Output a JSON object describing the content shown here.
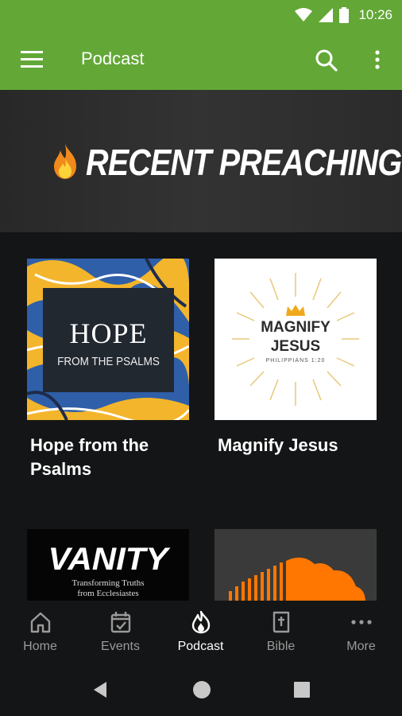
{
  "status_bar": {
    "time": "10:26",
    "icons": [
      "wifi-icon",
      "cellular-signal-icon",
      "battery-icon"
    ]
  },
  "app_bar": {
    "title": "Podcast",
    "icons": [
      "menu-icon",
      "search-icon",
      "more-vertical-icon"
    ]
  },
  "banner": {
    "icon": "flame-icon",
    "text": "RECENT PREACHING"
  },
  "podcasts": [
    {
      "title": "Hope from the Psalms",
      "art_title": "HOPE",
      "art_subtitle": "FROM THE PSALMS"
    },
    {
      "title": "Magnify Jesus",
      "art_line1": "MAGNIFY",
      "art_line2": "JESUS",
      "art_line3": "PHILIPPIANS 1:20"
    },
    {
      "title": "",
      "art_title": "VANITY",
      "art_line1": "Transforming Truths",
      "art_line2": "from Ecclesiastes"
    },
    {
      "title": "",
      "art_icon": "soundcloud-icon"
    }
  ],
  "bottom_nav": [
    {
      "label": "Home",
      "icon": "home-icon",
      "active": false
    },
    {
      "label": "Events",
      "icon": "calendar-icon",
      "active": false
    },
    {
      "label": "Podcast",
      "icon": "flame-icon",
      "active": true
    },
    {
      "label": "Bible",
      "icon": "bible-icon",
      "active": false
    },
    {
      "label": "More",
      "icon": "more-horizontal-icon",
      "active": false
    }
  ],
  "system_nav": [
    "back-icon",
    "home-circle-icon",
    "recents-icon"
  ],
  "colors": {
    "primary": "#63a837",
    "background": "#141516",
    "nav_inactive": "#9a9a9a",
    "soundcloud": "#ff7700"
  }
}
